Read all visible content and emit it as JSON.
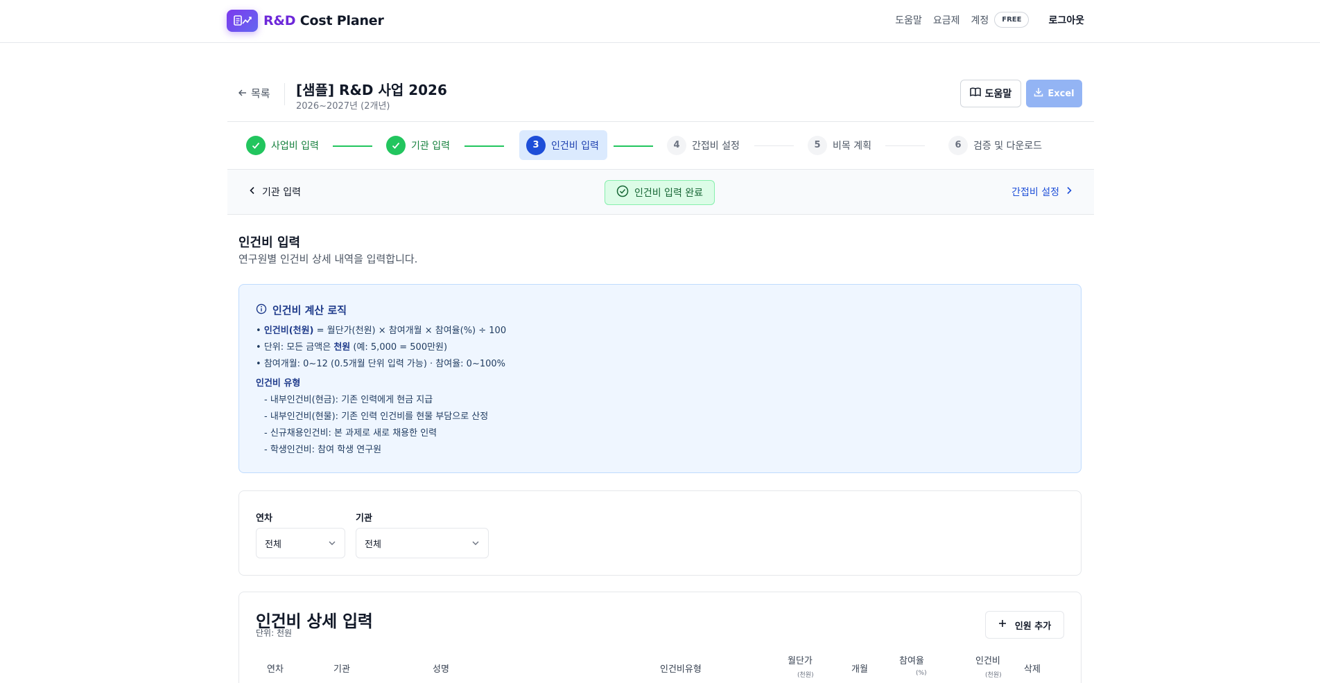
{
  "app": {
    "logo_rd": "R&D",
    "logo_rest": " Cost Planer"
  },
  "nav": {
    "help": "도움말",
    "pricing": "요금제",
    "account": "계정",
    "plan": "FREE",
    "logout": "로그아웃"
  },
  "project": {
    "back": "목록",
    "title": "[샘플] R&D 사업 2026",
    "period": "2026~2027년 (2개년)",
    "help_button": "도움말",
    "excel_button": "Excel"
  },
  "steps": [
    {
      "num": "1",
      "label": "사업비 입력",
      "state": "done"
    },
    {
      "num": "2",
      "label": "기관 입력",
      "state": "done"
    },
    {
      "num": "3",
      "label": "인건비 입력",
      "state": "active"
    },
    {
      "num": "4",
      "label": "간접비 설정",
      "state": "todo"
    },
    {
      "num": "5",
      "label": "비목 계획",
      "state": "todo"
    },
    {
      "num": "6",
      "label": "검증 및 다운로드",
      "state": "todo"
    }
  ],
  "stepnav": {
    "prev": "기관 입력",
    "status": "인건비 입력 완료",
    "next": "간접비 설정"
  },
  "section": {
    "title": "인건비 입력",
    "desc": "연구원별 인건비 상세 내역을 입력합니다."
  },
  "info": {
    "title": "인건비 계산 로직",
    "line1_bold": "인건비(천원)",
    "line1_rest": " = 월단가(천원) × 참여개월 × 참여율(%) ÷ 100",
    "line2_pre": "단위: 모든 금액은 ",
    "line2_bold": "천원",
    "line2_post": " (예: 5,000 = 500만원)",
    "line3": "참여개월: 0~12 (0.5개월 단위 입력 가능) · 참여율: 0~100%",
    "types_title": "인건비 유형",
    "types": [
      "- 내부인건비(현금): 기존 인력에게 현금 지급",
      "- 내부인건비(현물): 기존 인력 인건비를 현물 부담으로 산정",
      "- 신규채용인건비: 본 과제로 새로 채용한 인력",
      "- 학생인건비: 참여 학생 연구원"
    ]
  },
  "filter": {
    "year_label": "연차",
    "year_value": "전체",
    "org_label": "기관",
    "org_value": "전체"
  },
  "detail": {
    "title": "인건비 상세 입력",
    "unit": "단위: 천원",
    "add_button": "인원 추가",
    "columns": {
      "year": "연차",
      "org": "기관",
      "name": "성명",
      "type": "인건비유형",
      "monthly": "월단가",
      "monthly_unit": "(천원)",
      "months": "개월",
      "rate": "참여율",
      "rate_unit": "(%)",
      "cost": "인건비",
      "cost_unit": "(천원)",
      "delete": "삭제"
    }
  },
  "colors": {
    "brand": "#6d28d9",
    "accent": "#1d4ed8",
    "success": "#22c55e"
  }
}
